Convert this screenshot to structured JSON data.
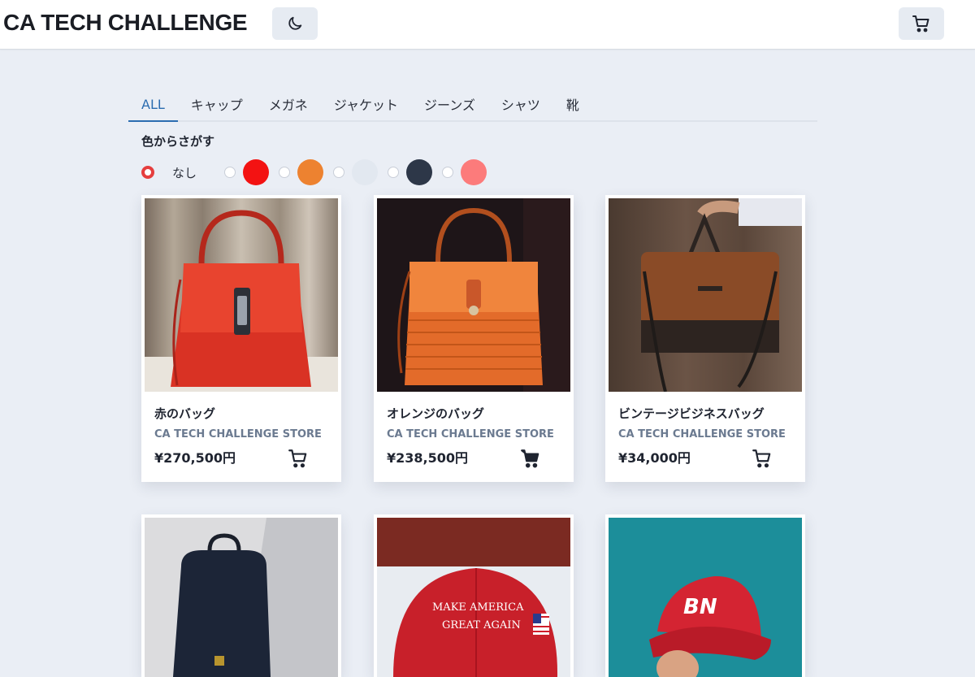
{
  "header": {
    "title": "CA TECH CHALLENGE",
    "theme_icon": "moon-icon",
    "cart_icon": "cart-icon"
  },
  "tabs": [
    {
      "label": "ALL",
      "active": true
    },
    {
      "label": "キャップ",
      "active": false
    },
    {
      "label": "メガネ",
      "active": false
    },
    {
      "label": "ジャケット",
      "active": false
    },
    {
      "label": "ジーンズ",
      "active": false
    },
    {
      "label": "シャツ",
      "active": false
    },
    {
      "label": "靴",
      "active": false
    }
  ],
  "color_filter": {
    "title": "色からさがす",
    "none_label": "なし",
    "selected": "none",
    "colors": [
      "#f31212",
      "#ed8230",
      "#e2e8f0",
      "#2d3748",
      "#fc7b7b"
    ]
  },
  "products": [
    {
      "name": "赤のバッグ",
      "store": "CA TECH CHALLENGE STORE",
      "price": "¥270,500円",
      "cart_icon": "cart-outline-icon",
      "image": "red handbag"
    },
    {
      "name": "オレンジのバッグ",
      "store": "CA TECH CHALLENGE STORE",
      "price": "¥238,500円",
      "cart_icon": "cart-filled-icon",
      "image": "orange wicker handbag"
    },
    {
      "name": "ビンテージビジネスバッグ",
      "store": "CA TECH CHALLENGE STORE",
      "price": "¥34,000円",
      "cart_icon": "cart-outline-icon",
      "image": "brown leather business bag"
    },
    {
      "image": "navy backpack"
    },
    {
      "image": "red cap",
      "cap_text_1": "MAKE AMERICA",
      "cap_text_2": "GREAT AGAIN"
    },
    {
      "image": "red cap on teal",
      "cap_logo": "BN"
    }
  ]
}
